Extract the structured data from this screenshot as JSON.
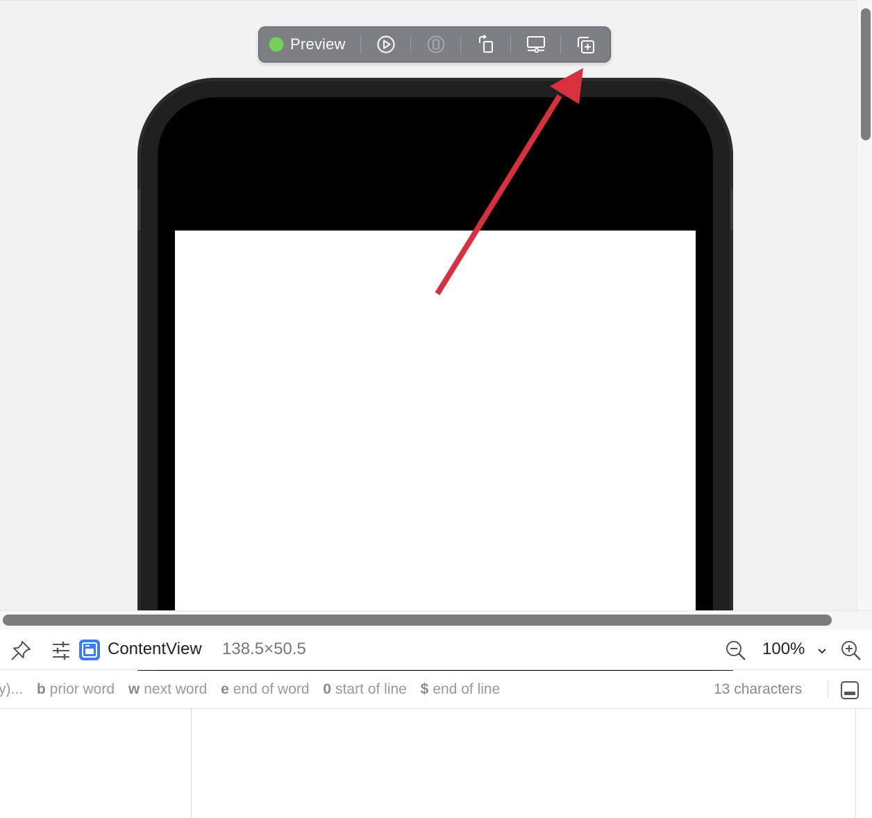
{
  "preview_toolbar": {
    "label": "Preview",
    "status_color": "#74d15a",
    "buttons": [
      {
        "name": "live-preview",
        "icon": "play-circle-icon"
      },
      {
        "name": "device-selector",
        "icon": "device-circle-icon",
        "disabled": true
      },
      {
        "name": "rotate",
        "icon": "rotate-device-icon"
      },
      {
        "name": "device-settings",
        "icon": "display-settings-icon"
      },
      {
        "name": "duplicate-preview",
        "icon": "duplicate-plus-icon"
      }
    ]
  },
  "annotation": {
    "arrow_color": "#d8303e",
    "points_to": "duplicate-preview-button"
  },
  "editor_bar": {
    "view_name": "ContentView",
    "view_size": "138.5×50.5",
    "zoom": "100%",
    "accent": "#3b7ef0"
  },
  "hint_bar": {
    "prefix": "y)...",
    "hints": [
      {
        "key": "b",
        "desc": "prior word"
      },
      {
        "key": "w",
        "desc": "next word"
      },
      {
        "key": "e",
        "desc": "end of word"
      },
      {
        "key": "0",
        "desc": "start of line"
      },
      {
        "key": "$",
        "desc": "end of line"
      }
    ],
    "char_count": "13 characters"
  }
}
